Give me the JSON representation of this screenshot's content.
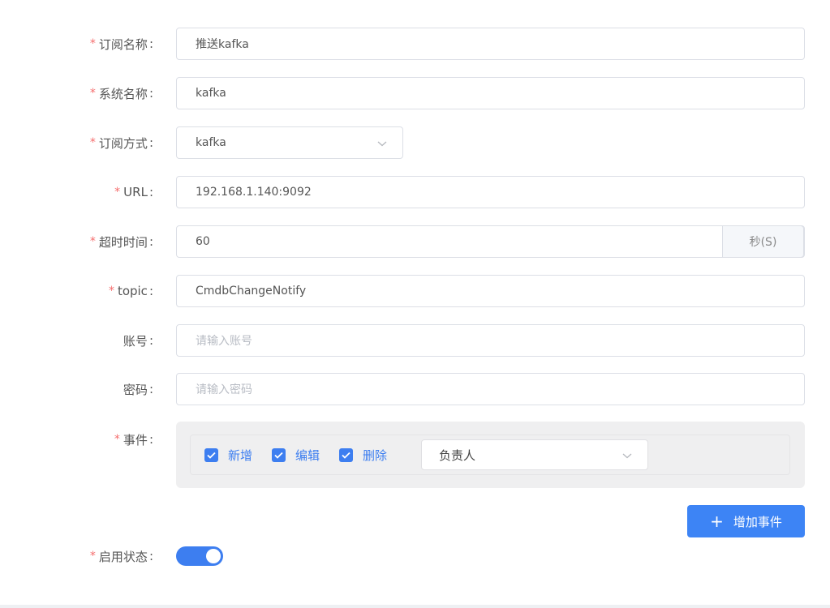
{
  "form": {
    "subscription_name": {
      "label": "订阅名称",
      "value": "推送kafka",
      "required": true
    },
    "system_name": {
      "label": "系统名称",
      "value": "kafka",
      "required": true
    },
    "subscription_method": {
      "label": "订阅方式",
      "value": "kafka",
      "required": true
    },
    "url": {
      "label": "URL",
      "value": "192.168.1.140:9092",
      "required": true
    },
    "timeout": {
      "label": "超时时间",
      "value": "60",
      "suffix": "秒(S)",
      "required": true
    },
    "topic": {
      "label": "topic",
      "value": "CmdbChangeNotify",
      "required": true
    },
    "account": {
      "label": "账号",
      "placeholder": "请输入账号",
      "required": false
    },
    "password": {
      "label": "密码",
      "placeholder": "请输入密码",
      "required": false
    },
    "events": {
      "label": "事件",
      "required": true,
      "options": [
        {
          "label": "新增",
          "checked": true
        },
        {
          "label": "编辑",
          "checked": true
        },
        {
          "label": "删除",
          "checked": true
        }
      ],
      "owner_select": {
        "value": "负责人"
      }
    },
    "add_event_button": {
      "label": "增加事件"
    },
    "enable_status": {
      "label": "启用状态",
      "required": true,
      "enabled": true
    }
  },
  "symbols": {
    "required_mark": "*",
    "colon": ":",
    "plus": "+"
  },
  "colors": {
    "accent": "#3d7ef0",
    "required": "#f56c6c"
  },
  "icons": {
    "chevron": "chevron-down-icon",
    "check": "check-icon",
    "plus": "plus-icon"
  }
}
